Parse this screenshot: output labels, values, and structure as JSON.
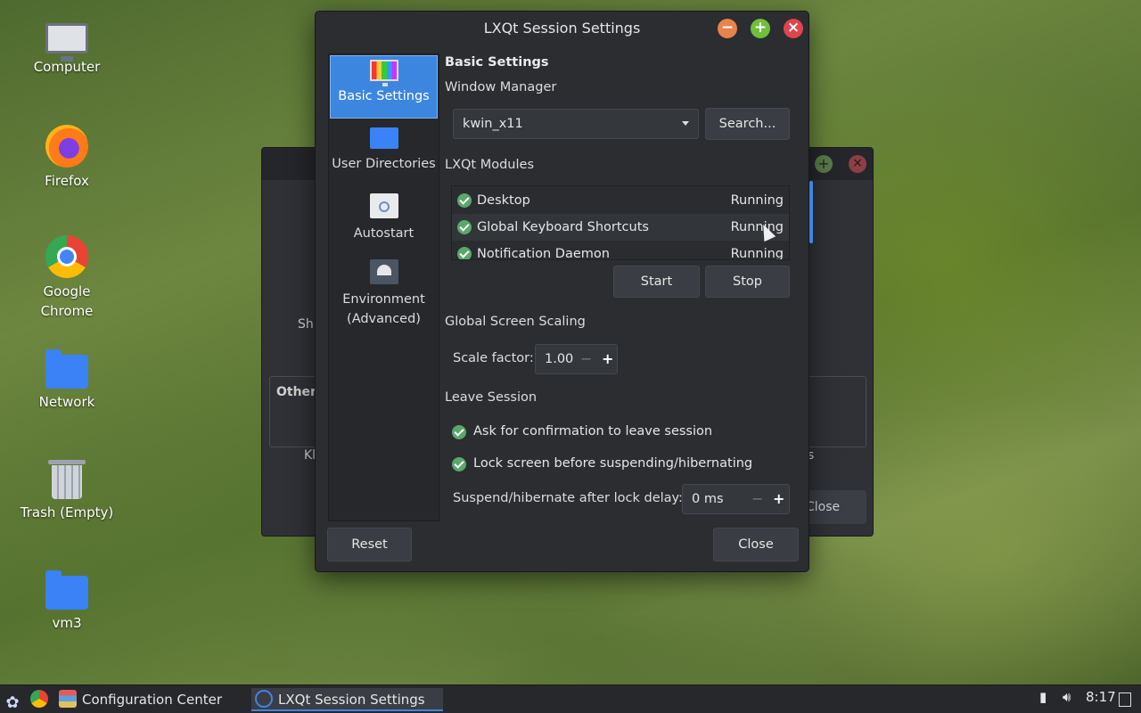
{
  "desktop": {
    "icons": [
      {
        "label": "Computer",
        "icon": "computer-icon"
      },
      {
        "label": "Firefox",
        "icon": "firefox-icon"
      },
      {
        "label": "Google Chrome",
        "icon": "chrome-icon"
      },
      {
        "label": "Network",
        "icon": "network-folder-icon"
      },
      {
        "label": "Trash (Empty)",
        "icon": "trash-icon"
      },
      {
        "label": "vm3",
        "icon": "home-folder-icon"
      }
    ]
  },
  "background_window": {
    "partial_texts": {
      "sh": "Sh",
      "other": "Other",
      "kl": "Kl",
      "s": "s",
      "close": "Close"
    }
  },
  "window": {
    "title": "LXQt Session Settings",
    "sidebar": {
      "items": [
        {
          "label": "Basic Settings",
          "icon": "monitor-icon",
          "active": true
        },
        {
          "label": "User Directories",
          "icon": "folder-icon",
          "active": false
        },
        {
          "label": "Autostart",
          "icon": "autostart-icon",
          "active": false
        },
        {
          "label": "Environment (Advanced)",
          "icon": "environment-icon",
          "active": false
        }
      ]
    },
    "basic": {
      "heading": "Basic Settings",
      "wm_label": "Window Manager",
      "wm_value": "kwin_x11",
      "search_button": "Search...",
      "modules_label": "LXQt Modules",
      "modules": [
        {
          "name": "Desktop",
          "status": "Running"
        },
        {
          "name": "Global Keyboard Shortcuts",
          "status": "Running"
        },
        {
          "name": "Notification Daemon",
          "status": "Running"
        }
      ],
      "start_button": "Start",
      "stop_button": "Stop",
      "scaling_label": "Global Screen Scaling",
      "scale_factor_label": "Scale factor:",
      "scale_factor_value": "1.00",
      "leave_label": "Leave Session",
      "ask_confirm": "Ask for confirmation to leave session",
      "lock_screen": "Lock screen before suspending/hibernating",
      "delay_label": "Suspend/hibernate after lock delay:",
      "delay_value": "0 ms"
    },
    "reset_button": "Reset",
    "close_button": "Close"
  },
  "taskbar": {
    "tasks": [
      {
        "label": "Configuration Center",
        "active": false
      },
      {
        "label": "LXQt Session Settings",
        "active": true
      }
    ],
    "clock": "8:17"
  },
  "colors": {
    "accent": "#3d86e0",
    "check": "#5aa86a",
    "window_bg": "#2b2d31"
  }
}
